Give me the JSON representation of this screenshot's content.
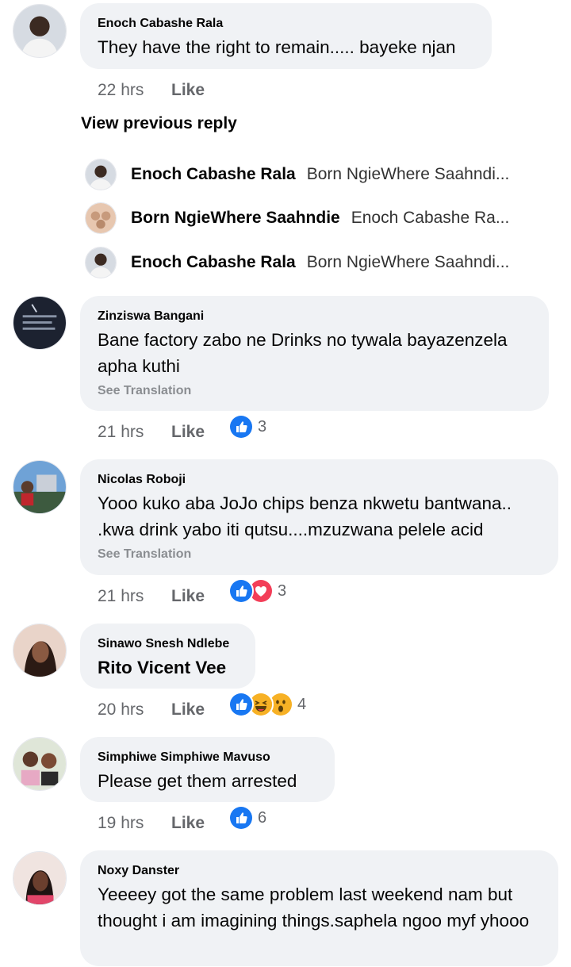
{
  "comments": [
    {
      "name": "Enoch Cabashe Rala",
      "text": "They have the right to remain..... bayeke njan",
      "time": "22 hrs",
      "like": "Like"
    },
    {
      "name": "Zinziswa Bangani",
      "text": "Bane factory zabo ne Drinks no tywala bayazenzela apha kuthi",
      "see_translation": "See Translation",
      "time": "21 hrs",
      "like": "Like",
      "reactions": [
        "like"
      ],
      "reaction_count": "3"
    },
    {
      "name": "Nicolas Roboji",
      "text": "Yooo kuko aba JoJo chips benza nkwetu bantwana.. .kwa drink yabo iti qutsu....mzuzwana pelele acid",
      "see_translation": "See Translation",
      "time": "21 hrs",
      "like": "Like",
      "reactions": [
        "like",
        "love"
      ],
      "reaction_count": "3"
    },
    {
      "name": "Sinawo Snesh Ndlebe",
      "text": "Rito Vicent Vee",
      "time": "20 hrs",
      "like": "Like",
      "reactions": [
        "like",
        "haha",
        "wow"
      ],
      "reaction_count": "4"
    },
    {
      "name": "Simphiwe Simphiwe Mavuso",
      "text": "Please get them arrested",
      "time": "19 hrs",
      "like": "Like",
      "reactions": [
        "like"
      ],
      "reaction_count": "6"
    },
    {
      "name": "Noxy Danster",
      "text": "Yeeeey got the same problem last weekend nam but thought i am imagining things.saphela ngoo myf yhooo"
    }
  ],
  "view_previous": "View previous reply",
  "replies": [
    {
      "name": "Enoch Cabashe Rala",
      "text": "Born NgieWhere Saahndi..."
    },
    {
      "name": "Born NgieWhere Saahndie",
      "text": "Enoch Cabashe Ra..."
    },
    {
      "name": "Enoch Cabashe Rala",
      "text": "Born NgieWhere Saahndi..."
    }
  ],
  "colors": {
    "bubble": "#f0f2f5",
    "meta": "#65676b",
    "like_blue": "#1877f2",
    "love_red": "#f33e58",
    "haha_yellow": "#f7b125"
  }
}
